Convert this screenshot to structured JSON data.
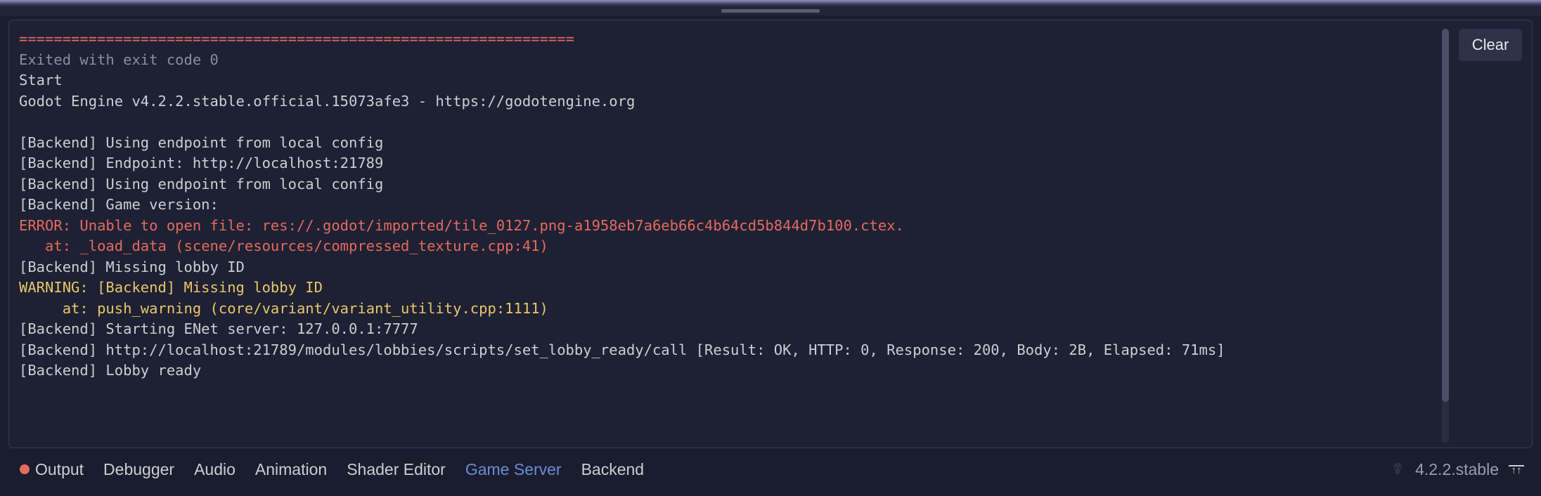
{
  "console": {
    "sep": "================================================================",
    "exit": "Exited with exit code 0",
    "lines": [
      "Start",
      "Godot Engine v4.2.2.stable.official.15073afe3 - https://godotengine.org",
      "",
      "[Backend] Using endpoint from local config",
      "[Backend] Endpoint: http://localhost:21789",
      "[Backend] Using endpoint from local config",
      "[Backend] Game version:"
    ],
    "error1": "ERROR: Unable to open file: res://.godot/imported/tile_0127.png-a1958eb7a6eb66c4b64cd5b844d7b100.ctex.",
    "error2": "   at: _load_data (scene/resources/compressed_texture.cpp:41)",
    "line_ml": "[Backend] Missing lobby ID",
    "warn1": "WARNING: [Backend] Missing lobby ID",
    "warn2": "     at: push_warning (core/variant/variant_utility.cpp:1111)",
    "lines2": [
      "[Backend] Starting ENet server: 127.0.0.1:7777",
      "[Backend] http://localhost:21789/modules/lobbies/scripts/set_lobby_ready/call [Result: OK, HTTP: 0, Response: 200, Body: 2B, Elapsed: 71ms]",
      "[Backend] Lobby ready"
    ]
  },
  "buttons": {
    "clear": "Clear"
  },
  "tabs": {
    "output": "Output",
    "debugger": "Debugger",
    "audio": "Audio",
    "animation": "Animation",
    "shader": "Shader Editor",
    "gameserver": "Game Server",
    "backend": "Backend"
  },
  "status": {
    "version": "4.2.2.stable"
  }
}
